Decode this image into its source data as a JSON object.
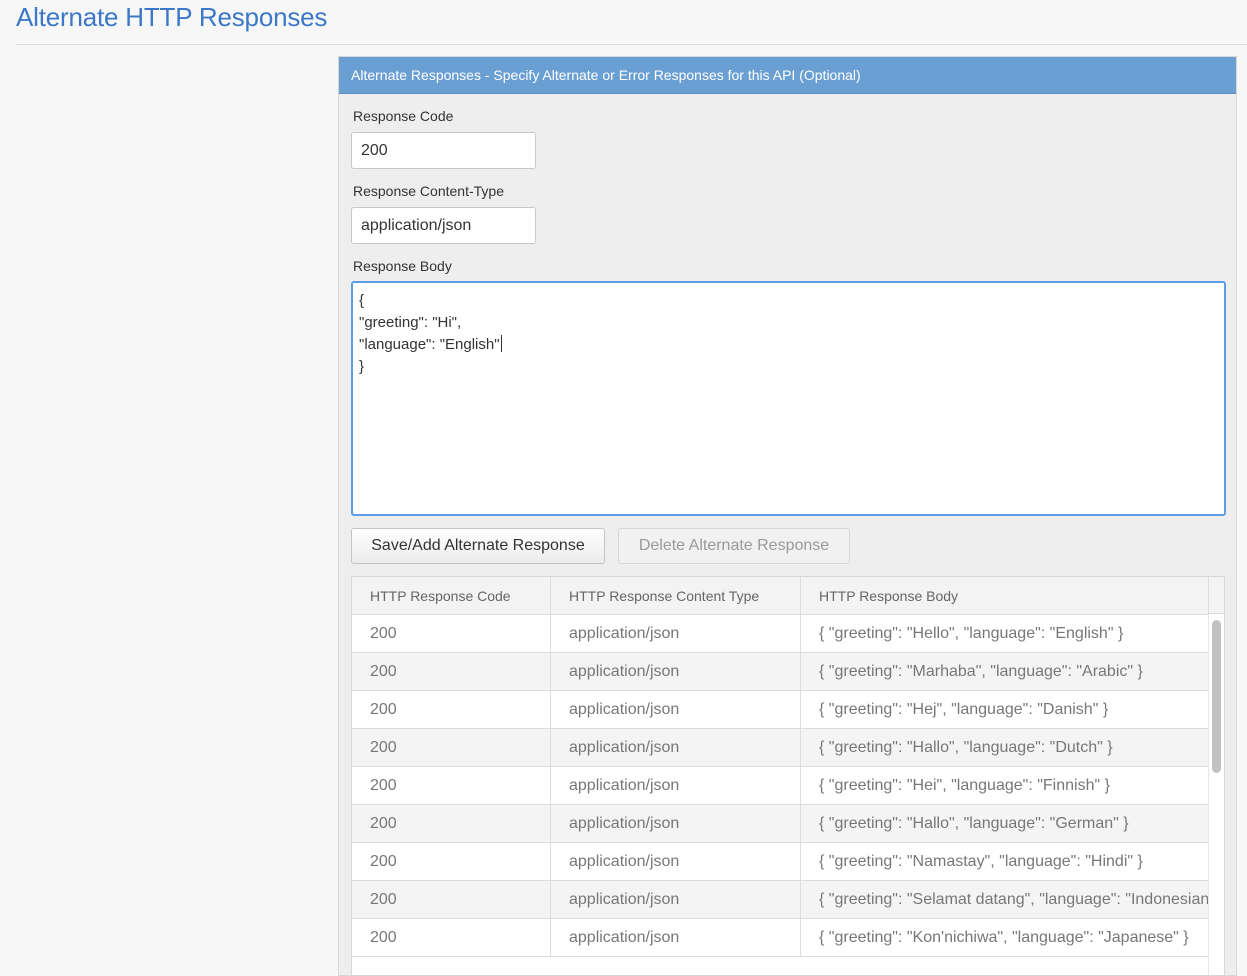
{
  "page": {
    "title": "Alternate HTTP Responses"
  },
  "panel": {
    "header": "Alternate Responses - Specify Alternate or Error Responses for this API (Optional)"
  },
  "form": {
    "response_code_label": "Response Code",
    "response_code_value": "200",
    "content_type_label": "Response Content-Type",
    "content_type_value": "application/json",
    "body_label": "Response Body",
    "body_lines": [
      "{",
      "\"greeting\": \"Hi\",",
      "\"language\": \"English\"",
      "}"
    ]
  },
  "buttons": {
    "save_label": "Save/Add Alternate Response",
    "delete_label": "Delete Alternate Response",
    "delete_enabled": false
  },
  "table": {
    "headers": [
      "HTTP Response Code",
      "HTTP Response Content Type",
      "HTTP Response Body"
    ],
    "rows": [
      [
        "200",
        "application/json",
        "{ \"greeting\": \"Hello\", \"language\": \"English\" }"
      ],
      [
        "200",
        "application/json",
        "{ \"greeting\": \"Marhaba\", \"language\": \"Arabic\" }"
      ],
      [
        "200",
        "application/json",
        "{ \"greeting\": \"Hej\", \"language\": \"Danish\" }"
      ],
      [
        "200",
        "application/json",
        "{ \"greeting\": \"Hallo\", \"language\": \"Dutch\" }"
      ],
      [
        "200",
        "application/json",
        "{ \"greeting\": \"Hei\", \"language\": \"Finnish\" }"
      ],
      [
        "200",
        "application/json",
        "{ \"greeting\": \"Hallo\", \"language\": \"German\" }"
      ],
      [
        "200",
        "application/json",
        "{ \"greeting\": \"Namastay\", \"language\": \"Hindi\" }"
      ],
      [
        "200",
        "application/json",
        "{ \"greeting\": \"Selamat datang\", \"language\": \"Indonesian\" }"
      ],
      [
        "200",
        "application/json",
        "{ \"greeting\": \"Kon'nichiwa\", \"language\": \"Japanese\" }"
      ]
    ]
  },
  "colors": {
    "title": "#3c78c8",
    "panel_header_bg": "#6a9fd3",
    "focus_border": "#5b9ee6"
  }
}
